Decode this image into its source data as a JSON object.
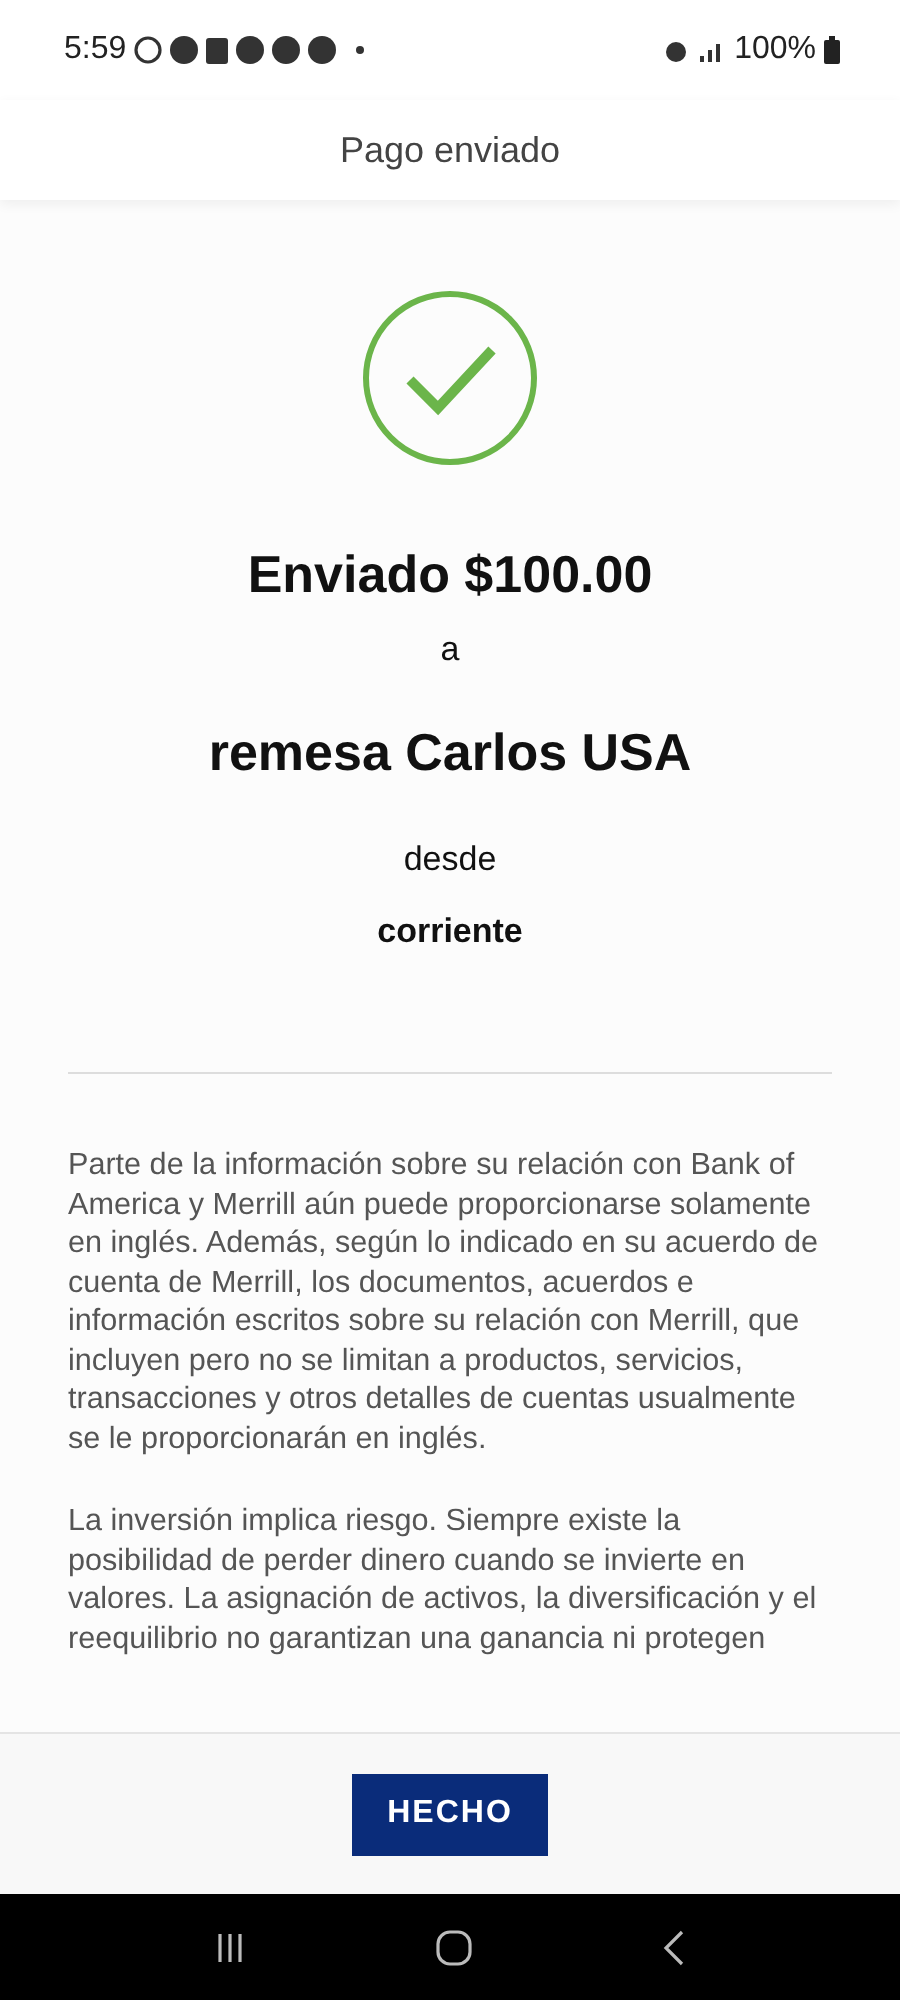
{
  "status_bar": {
    "time": "5:59",
    "battery": "100%"
  },
  "header": {
    "title": "Pago enviado"
  },
  "confirmation": {
    "amount_line": "Enviado $100.00",
    "to_word": "a",
    "recipient": "remesa Carlos USA",
    "from_word": "desde",
    "account": "corriente"
  },
  "disclosures": [
    "Parte de la información sobre su relación con Bank of America y Merrill aún puede proporcionarse solamente en inglés. Además, según lo indicado en su acuerdo de cuenta de Merrill, los documentos, acuerdos e información escritos sobre su relación con Merrill, que incluyen pero no se limitan a productos, servicios, transacciones y otros detalles de cuentas usualmente se le proporcionarán en inglés.",
    "La inversión implica riesgo. Siempre existe la posibilidad de perder dinero cuando se invierte en valores. La asignación de activos, la diversificación y el reequilibrio no garantizan una ganancia ni protegen"
  ],
  "footer": {
    "button": "HECHO"
  }
}
